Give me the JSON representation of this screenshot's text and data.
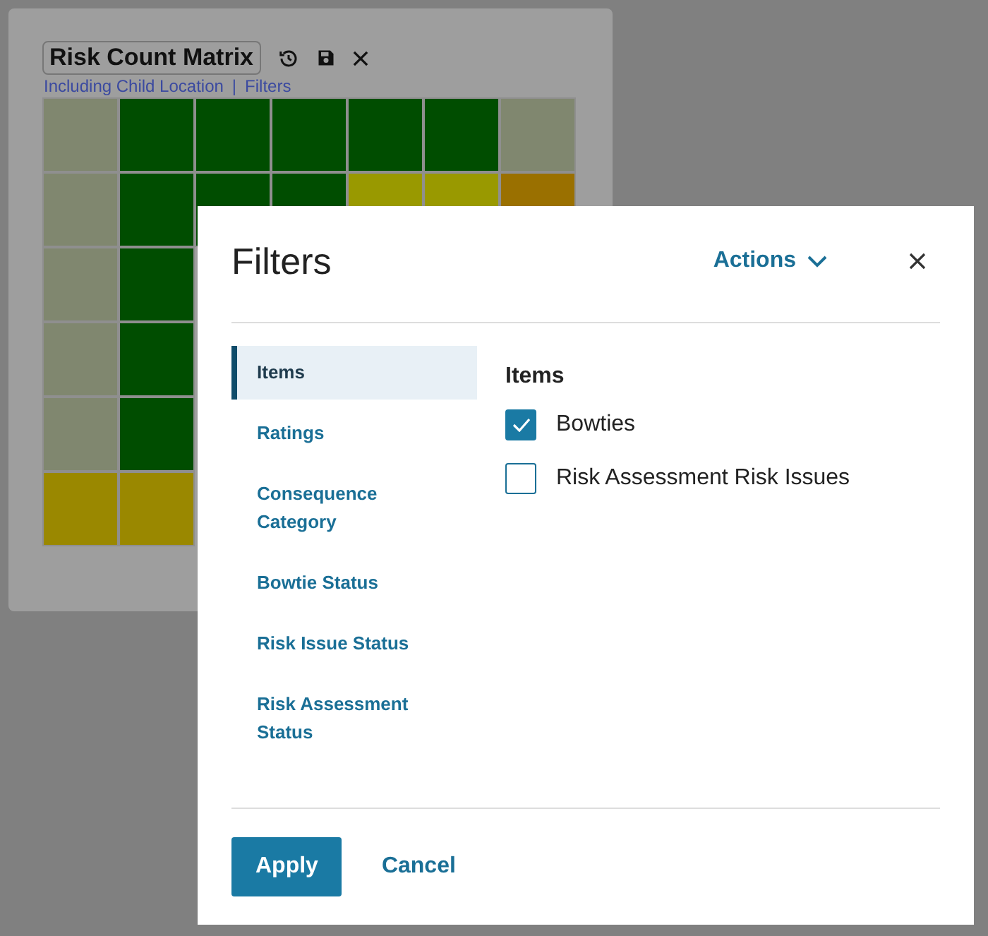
{
  "widget": {
    "title": "Risk Count Matrix",
    "links": [
      "Including Child Location",
      "|",
      "Filters"
    ],
    "matrix": [
      {
        "cells": [
          {
            "color": "#80876f"
          },
          {
            "color": "#004d00"
          },
          {
            "color": "#004d00"
          },
          {
            "color": "#004d00"
          },
          {
            "color": "#004d00"
          },
          {
            "color": "#004d00"
          },
          {
            "color": "#80876f"
          }
        ]
      },
      {
        "cells": [
          {
            "color": "#80876f"
          },
          {
            "color": "#004d00"
          },
          {
            "color": "#004d00"
          },
          {
            "color": "#004d00"
          },
          {
            "color": "#999900"
          },
          {
            "color": "#999900"
          },
          {
            "color": "#9a7000"
          }
        ]
      },
      {
        "cells": [
          {
            "color": "#80876f"
          },
          {
            "color": "#004d00"
          }
        ]
      },
      {
        "cells": [
          {
            "color": "#80876f"
          },
          {
            "color": "#004d00"
          }
        ]
      },
      {
        "cells": [
          {
            "color": "#80876f"
          },
          {
            "color": "#004d00"
          }
        ]
      },
      {
        "cells": [
          {
            "color": "#9a8800"
          },
          {
            "color": "#9a8800"
          }
        ]
      }
    ]
  },
  "dialog": {
    "title": "Filters",
    "actions": "Actions",
    "nav": [
      {
        "label": "Items",
        "selected": true
      },
      {
        "label": "Ratings",
        "selected": false
      },
      {
        "label": "Consequence Category",
        "selected": false
      },
      {
        "label": "Bowtie Status",
        "selected": false
      },
      {
        "label": "Risk Issue Status",
        "selected": false
      },
      {
        "label": "Risk Assessment Status",
        "selected": false
      }
    ],
    "section": "Items",
    "options": [
      {
        "label": "Bowties",
        "checked": true
      },
      {
        "label": "Risk Assessment Risk Issues",
        "checked": false
      }
    ],
    "buttons": [
      "Apply",
      "Cancel"
    ]
  }
}
